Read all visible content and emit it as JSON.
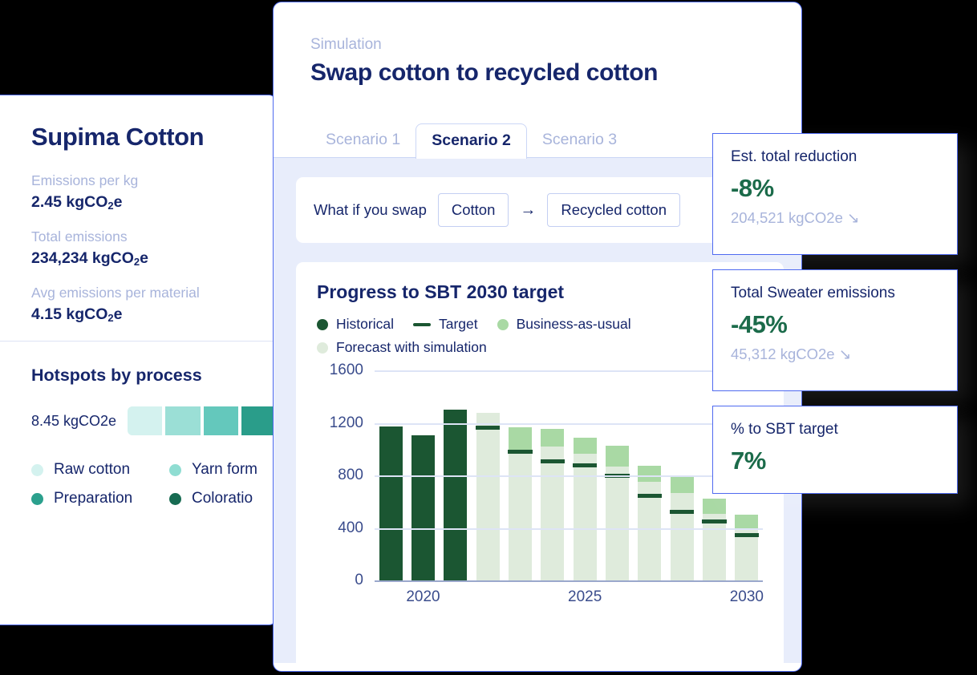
{
  "material_card": {
    "title": "Supima Cotton",
    "metrics": [
      {
        "label": "Emissions per kg",
        "value": "2.45 kgCO",
        "sub": "2",
        "suffix": "e"
      },
      {
        "label": "Total emissions",
        "value": "234,234 kgCO",
        "sub": "2",
        "suffix": "e"
      },
      {
        "label": "Avg emissions per material",
        "value": "4.15 kgCO",
        "sub": "2",
        "suffix": "e"
      }
    ],
    "hotspots": {
      "title": "Hotspots by process",
      "amount": "8.45 kgCO2e",
      "segments": [
        {
          "color": "#D4F2EF"
        },
        {
          "color": "#9BDFD6"
        },
        {
          "color": "#64C8BC"
        },
        {
          "color": "#2A9D8A"
        }
      ],
      "legend": [
        {
          "label": "Raw cotton",
          "color": "#D4F2EF"
        },
        {
          "label": "Yarn form",
          "color": "#8FDDD2"
        },
        {
          "label": "Preparation",
          "color": "#2BA08D"
        },
        {
          "label": "Coloratio",
          "color": "#176B52"
        }
      ]
    }
  },
  "simulation": {
    "eyebrow": "Simulation",
    "title": "Swap cotton to recycled cotton",
    "tabs": [
      {
        "label": "Scenario 1",
        "active": false
      },
      {
        "label": "Scenario 2",
        "active": true
      },
      {
        "label": "Scenario 3",
        "active": false
      }
    ],
    "swap": {
      "label": "What if you swap",
      "from": "Cotton",
      "arrow": "→",
      "to": "Recycled cotton"
    }
  },
  "stats": [
    {
      "label": "Est. total reduction",
      "value": "-8%",
      "sub": "204,521 kgCO2e ↘"
    },
    {
      "label": "Total Sweater emissions",
      "value": "-45%",
      "sub": "45,312 kgCO2e ↘"
    },
    {
      "label": "% to SBT target",
      "value": "7%",
      "sub": ""
    }
  ],
  "chart_data": {
    "type": "bar",
    "title": "Progress to SBT 2030 target",
    "xlabel": "",
    "ylabel": "",
    "ylim": [
      0,
      1600
    ],
    "yticks": [
      1600,
      1200,
      800,
      400,
      0
    ],
    "grid": true,
    "legend_position": "top-left",
    "legend": [
      {
        "name": "Historical",
        "color": "#1B5632",
        "marker": "dot"
      },
      {
        "name": "Target",
        "color": "#1B5632",
        "marker": "line"
      },
      {
        "name": "Business-as-usual",
        "color": "#A9D9A4",
        "marker": "dot"
      },
      {
        "name": "Forecast with simulation",
        "color": "#DFEBDC",
        "marker": "dot"
      }
    ],
    "x": [
      2019,
      2020,
      2021,
      2022,
      2023,
      2024,
      2025,
      2026,
      2027,
      2028,
      2029,
      2030
    ],
    "xtick_labels": [
      {
        "value": 2020,
        "label": "2020"
      },
      {
        "value": 2025,
        "label": "2025"
      },
      {
        "value": 2030,
        "label": "2030"
      }
    ],
    "series": [
      {
        "name": "Historical",
        "color": "#1B5632",
        "values": [
          1175,
          1105,
          1300,
          null,
          null,
          null,
          null,
          null,
          null,
          null,
          null,
          null
        ]
      },
      {
        "name": "Forecast with simulation",
        "color": "#DFEBDC",
        "values": [
          null,
          null,
          null,
          1275,
          965,
          1020,
          965,
          870,
          750,
          665,
          510,
          400
        ]
      },
      {
        "name": "Business-as-usual",
        "color": "#A9D9A4",
        "values": [
          null,
          null,
          null,
          0,
          200,
          135,
          120,
          155,
          125,
          120,
          115,
          100
        ]
      },
      {
        "name": "Target",
        "color": "#1B5632",
        "type": "line-marker",
        "values": [
          null,
          null,
          null,
          1150,
          965,
          890,
          860,
          780,
          630,
          505,
          435,
          330
        ]
      }
    ]
  }
}
